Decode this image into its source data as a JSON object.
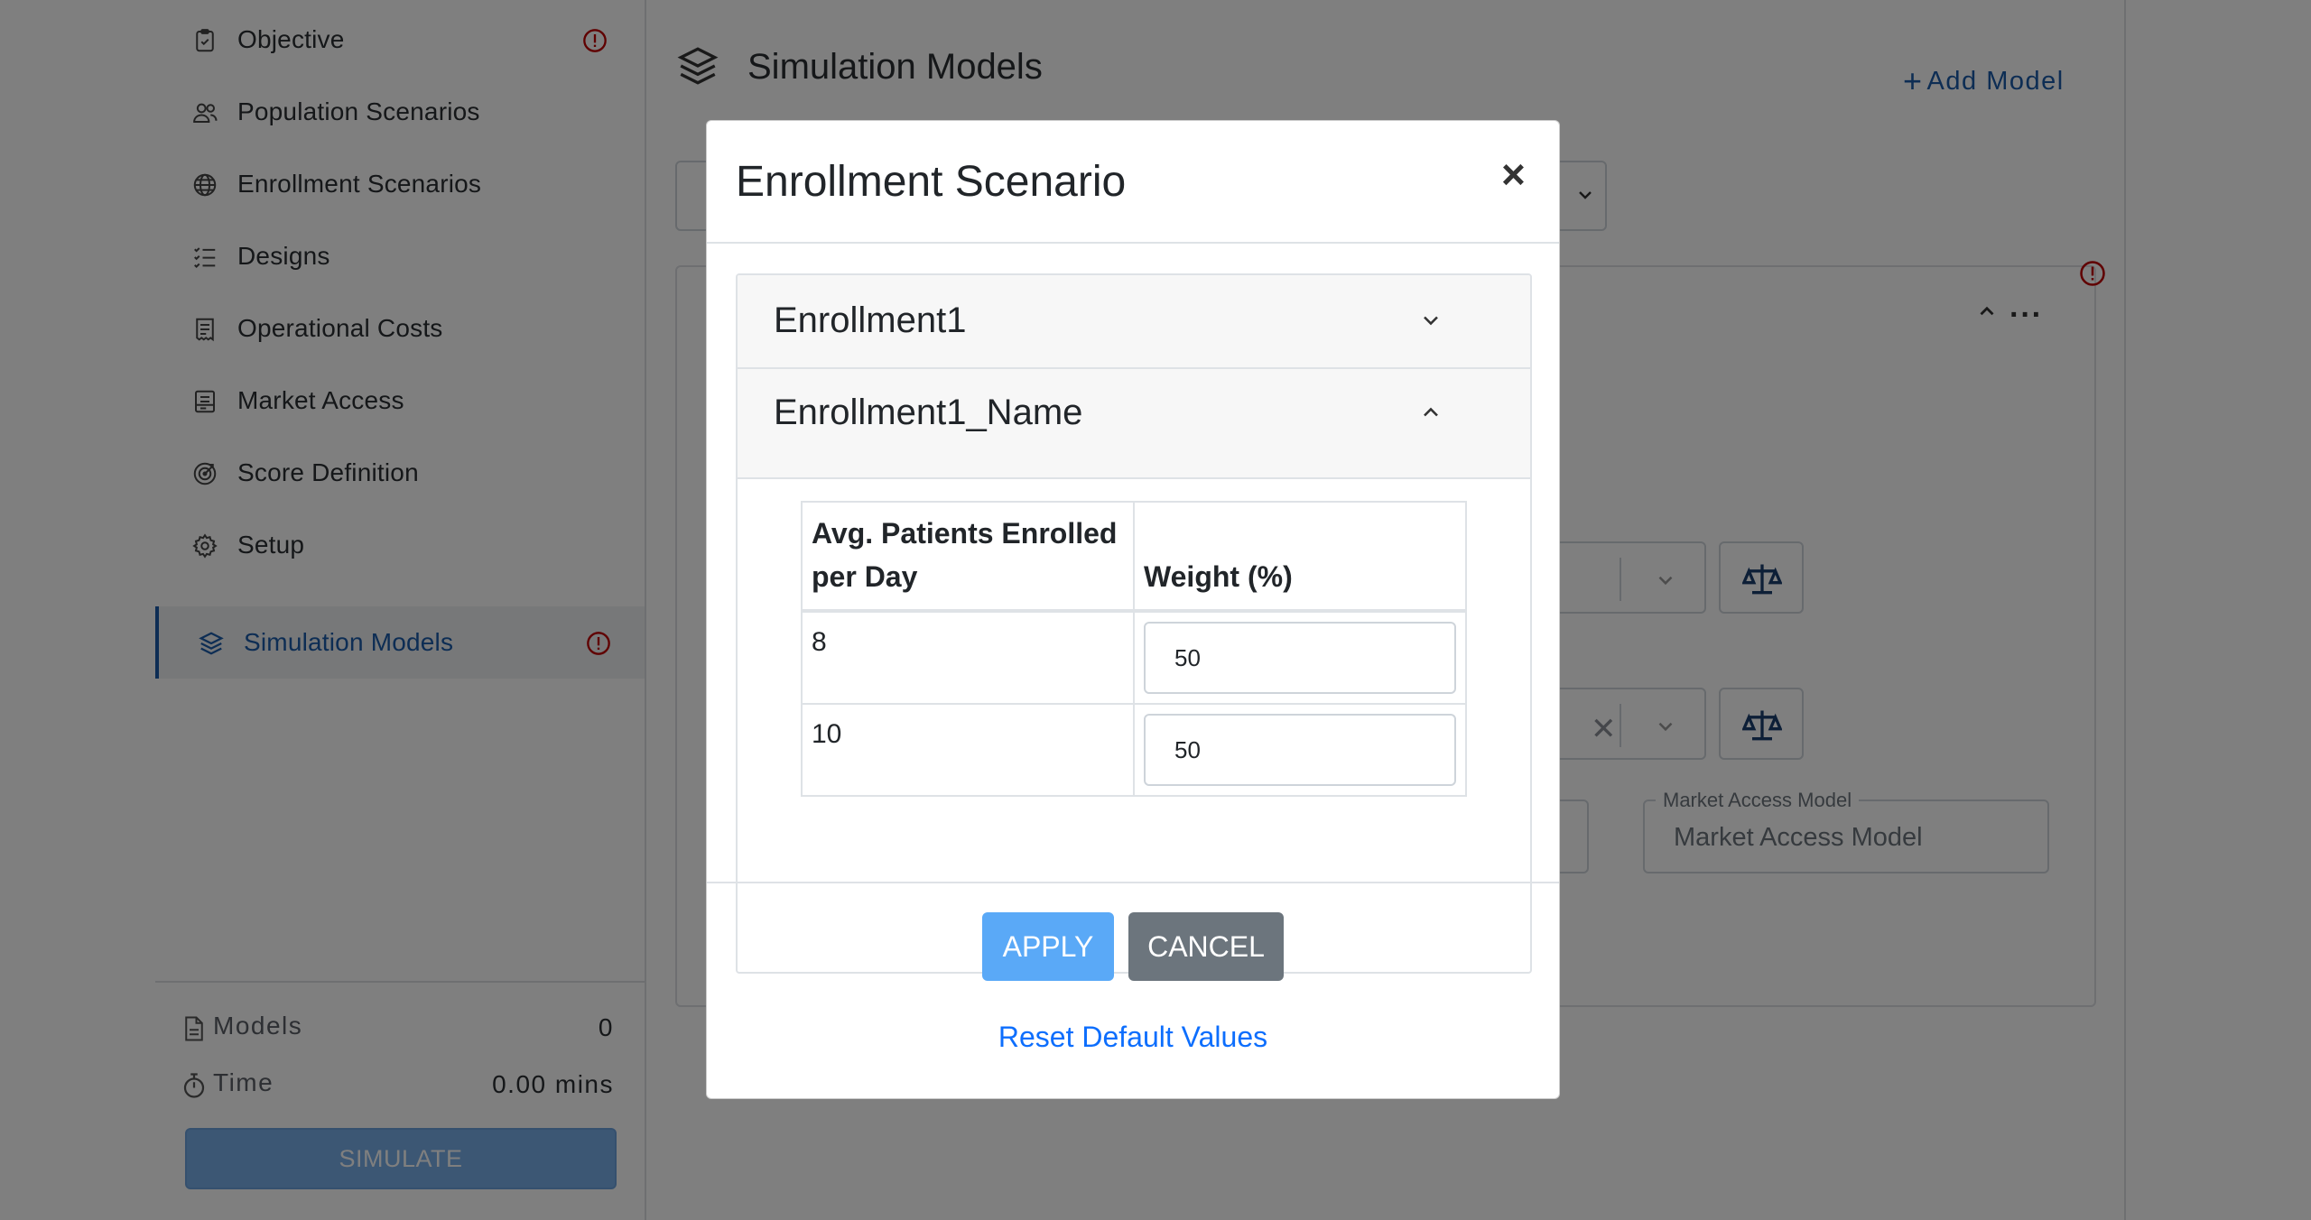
{
  "sidebar": {
    "items": [
      {
        "label": "Objective",
        "icon": "clipboard-check-icon",
        "warning": true
      },
      {
        "label": "Population Scenarios",
        "icon": "people-icon",
        "warning": false
      },
      {
        "label": "Enrollment Scenarios",
        "icon": "globe-icon",
        "warning": false
      },
      {
        "label": "Designs",
        "icon": "list-check-icon",
        "warning": false
      },
      {
        "label": "Operational Costs",
        "icon": "receipt-icon",
        "warning": false
      },
      {
        "label": "Market Access",
        "icon": "document-icon",
        "warning": false
      },
      {
        "label": "Score Definition",
        "icon": "target-icon",
        "warning": false
      },
      {
        "label": "Setup",
        "icon": "gear-icon",
        "warning": false
      },
      {
        "label": "Simulation Models",
        "icon": "layers-icon",
        "warning": true,
        "active": true
      }
    ],
    "stats": {
      "models_label": "Models",
      "models_value": "0",
      "time_label": "Time",
      "time_value": "0.00 mins"
    },
    "simulate_label": "SIMULATE"
  },
  "main": {
    "title": "Simulation Models",
    "add_model_label": "Add Model",
    "market_access_label": "Market Access Model",
    "market_access_placeholder": "Market Access Model"
  },
  "modal": {
    "title": "Enrollment Scenario",
    "close_label": "×",
    "accordion": [
      {
        "label": "Enrollment1",
        "expanded": false
      },
      {
        "label": "Enrollment1_Name",
        "expanded": true
      }
    ],
    "table": {
      "headers": [
        "Avg. Patients Enrolled per Day",
        "Weight (%)"
      ],
      "rows": [
        {
          "patients": "8",
          "weight": "50"
        },
        {
          "patients": "10",
          "weight": "50"
        }
      ]
    },
    "apply_label": "APPLY",
    "cancel_label": "CANCEL",
    "reset_label": "Reset Default Values"
  },
  "colors": {
    "accent": "#1a5aa8",
    "warning": "#c00000",
    "apply": "#5aa9f7",
    "cancel": "#6c757d",
    "link": "#0d6efd"
  }
}
